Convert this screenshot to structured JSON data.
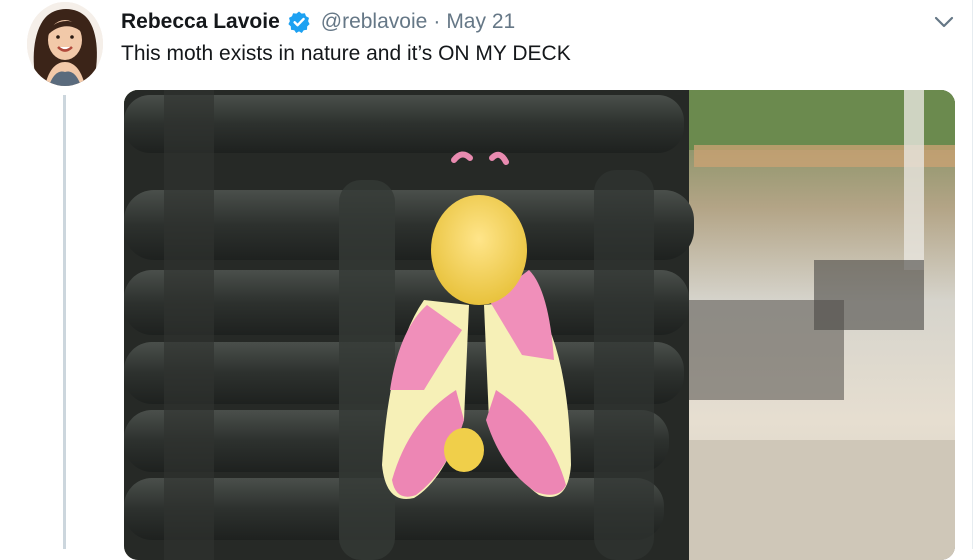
{
  "tweet": {
    "author": {
      "display_name": "Rebecca Lavoie",
      "handle": "@reblavoie",
      "verified": true
    },
    "separator": "·",
    "date": "May 21",
    "text": "This moth exists in nature and it’s ON MY DECK",
    "icons": {
      "verified": "verified-badge-icon",
      "more": "chevron-down-icon"
    },
    "colors": {
      "verified": "#1da1f2",
      "muted": "#657786",
      "text": "#14171a"
    }
  }
}
